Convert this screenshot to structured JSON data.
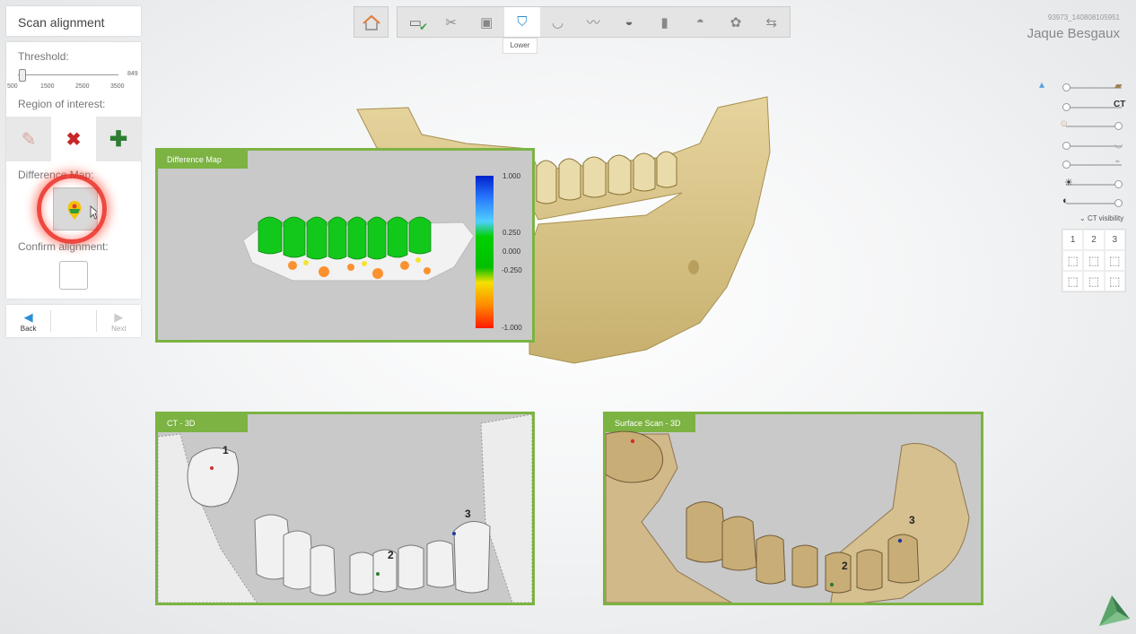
{
  "panel": {
    "title": "Scan alignment",
    "threshold_label": "Threshold:",
    "threshold_value": "849",
    "threshold_ticks": [
      "500",
      "1500",
      "2500",
      "3500"
    ],
    "threshold_fraction": 0.04,
    "roi_label": "Region of interest:",
    "roi_buttons": [
      {
        "icon": "erase-icon"
      },
      {
        "icon": "remove-x-icon"
      },
      {
        "icon": "add-plus-icon"
      }
    ],
    "diff_map_label": "Difference Map:",
    "confirm_label": "Confirm alignment:"
  },
  "nav": {
    "back_label": "Back",
    "next_label": "Next"
  },
  "toolbar": {
    "tooltip": "Lower",
    "steps": [
      "scanner-icon",
      "molar-cut-icon",
      "model-icon",
      "lower-jaw-tooth-icon",
      "arch-icon",
      "gingiva-icon",
      "crown-icon",
      "implant-icon",
      "abutment-icon",
      "guide-icon",
      "export-icon"
    ]
  },
  "patient": {
    "id": "93973_140808105951",
    "name": "Jaque Besgaux"
  },
  "right_panel": {
    "slider_labels": [
      "",
      "CT",
      "",
      "",
      "",
      "",
      ""
    ],
    "ct_visibility": "CT visibility",
    "view_numbers": [
      "1",
      "2",
      "3"
    ]
  },
  "viewports": {
    "diff_title": "Difference Map",
    "ct_title": "CT - 3D",
    "surf_title": "Surface Scan - 3D",
    "colorbar_labels": [
      "1.000",
      "0.250",
      "0.000",
      "-0.250",
      "-1.000"
    ],
    "ct_markers": [
      "1",
      "2",
      "3"
    ],
    "surf_markers": [
      "2",
      "3"
    ]
  },
  "colors": {
    "accent": "#7cb342",
    "bone": "#d9c58f",
    "highlight_ring": "#eb281e"
  }
}
